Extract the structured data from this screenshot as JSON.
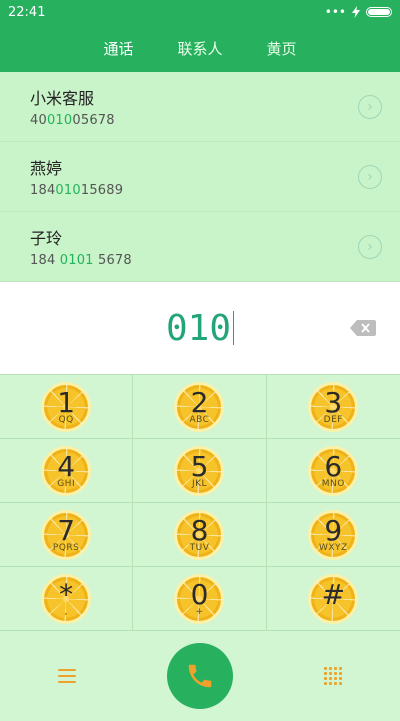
{
  "status": {
    "time": "22:41",
    "dots": "•••"
  },
  "tabs": [
    {
      "label": "通话"
    },
    {
      "label": "联系人"
    },
    {
      "label": "黄页"
    }
  ],
  "contacts": [
    {
      "name": "小米客服",
      "num_pre": "40",
      "num_hl": "010",
      "num_post": "05678"
    },
    {
      "name": "燕婷",
      "num_pre": "184",
      "num_hl": "010",
      "num_post": "15689"
    },
    {
      "name": "子玲",
      "num_pre": "184 ",
      "num_hl": "0101",
      "num_post": " 5678"
    }
  ],
  "dial": {
    "value": "010"
  },
  "keypad": [
    [
      {
        "d": "1",
        "l": "QQ"
      },
      {
        "d": "2",
        "l": "ABC"
      },
      {
        "d": "3",
        "l": "DEF"
      }
    ],
    [
      {
        "d": "4",
        "l": "GHI"
      },
      {
        "d": "5",
        "l": "JKL"
      },
      {
        "d": "6",
        "l": "MNO"
      }
    ],
    [
      {
        "d": "7",
        "l": "PQRS"
      },
      {
        "d": "8",
        "l": "TUV"
      },
      {
        "d": "9",
        "l": "WXYZ"
      }
    ],
    [
      {
        "d": "*",
        "l": ","
      },
      {
        "d": "0",
        "l": "+"
      },
      {
        "d": "#",
        "l": ""
      }
    ]
  ],
  "colors": {
    "brand": "#27b15f",
    "accent": "#f0a12b",
    "highlight": "#23b35a"
  },
  "icons": {
    "menu": "menu-icon",
    "call": "phone-icon",
    "dialpad": "dialpad-icon",
    "backspace": "backspace-icon"
  }
}
